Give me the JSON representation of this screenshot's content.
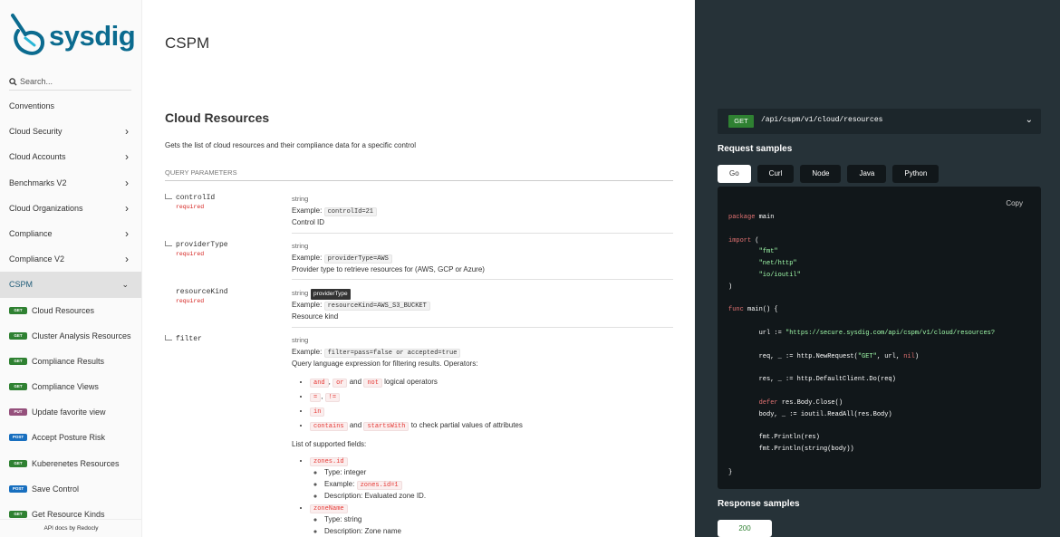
{
  "sidebar": {
    "logo_text": "sysdig",
    "search_placeholder": "Search...",
    "nav": [
      {
        "label": "Conventions"
      },
      {
        "label": "Cloud Security"
      },
      {
        "label": "Cloud Accounts"
      },
      {
        "label": "Benchmarks V2"
      },
      {
        "label": "Cloud Organizations"
      },
      {
        "label": "Compliance"
      },
      {
        "label": "Compliance V2"
      },
      {
        "label": "CSPM"
      }
    ],
    "sub_items": [
      {
        "method": "GET",
        "label": "Cloud Resources"
      },
      {
        "method": "GET",
        "label": "Cluster Analysis Resources"
      },
      {
        "method": "GET",
        "label": "Compliance Results"
      },
      {
        "method": "GET",
        "label": "Compliance Views"
      },
      {
        "method": "PUT",
        "label": "Update favorite view"
      },
      {
        "method": "POST",
        "label": "Accept Posture Risk"
      },
      {
        "method": "GET",
        "label": "Kuberenetes Resources"
      },
      {
        "method": "POST",
        "label": "Save Control"
      },
      {
        "method": "GET",
        "label": "Get Resource Kinds"
      }
    ],
    "footer": "API docs by Redocly",
    "colors": {
      "get": "#2f8132",
      "put": "#95507c",
      "post": "#186fbf"
    }
  },
  "main": {
    "page_title": "CSPM",
    "section_title": "Cloud Resources",
    "section_desc": "Gets the list of cloud resources and their compliance data for a specific control",
    "params_header": "QUERY PARAMETERS",
    "tooltip": "providerType",
    "params": [
      {
        "name": "controlId",
        "required": "required",
        "type": "string",
        "example_label": "Example:",
        "example": "controlId=21",
        "desc": "Control ID"
      },
      {
        "name": "providerType",
        "required": "required",
        "type": "string",
        "example_label": "Example:",
        "example": "providerType=AWS",
        "desc": "Provider type to retrieve resources for (AWS, GCP or Azure)"
      },
      {
        "name": "resourceKind",
        "required": "required",
        "type": "string",
        "example_label": "Example:",
        "example": "resourceKind=AWS_S3_BUCKET",
        "desc": "Resource kind"
      },
      {
        "name": "filter",
        "type": "string",
        "example_label": "Example:",
        "example": "filter=pass=false or accepted=true",
        "desc": "Query language expression for filtering results. Operators:"
      }
    ],
    "filter_ops": {
      "and": "and",
      "comma": ",",
      "or": "or",
      "and_word": "and",
      "not": "not",
      "logical_text": "logical operators",
      "eq": "=",
      "ne": "!=",
      "in": "in",
      "contains": "contains",
      "and_word2": "and",
      "startsWith": "startsWith",
      "partial_text": "to check partial values of attributes"
    },
    "fields_title": "List of supported fields:",
    "fields": [
      {
        "name": "zones.id",
        "type": "Type: integer",
        "example_label": "Example:",
        "example": "zones.id=1",
        "desc": "Description: Evaluated zone ID."
      },
      {
        "name": "zoneName",
        "type": "Type: string",
        "desc": "Description: Zone name"
      }
    ]
  },
  "right": {
    "method": "GET",
    "path": "/api/cspm/v1/cloud/resources",
    "request_title": "Request samples",
    "tabs": [
      "Go",
      "Curl",
      "Node",
      "Java",
      "Python"
    ],
    "copy": "Copy",
    "code": {
      "pkg": "package",
      "main_name": "main",
      "import": "import",
      "paren_open": "(",
      "imp1": "\"fmt\"",
      "imp2": "\"net/http\"",
      "imp3": "\"io/ioutil\"",
      "paren_close": ")",
      "func": "func",
      "func_sig": "main() {",
      "url_pre": "url := ",
      "url": "\"https://secure.sysdig.com/api/cspm/v1/cloud/resources?",
      "req_pre": "req, _ := http.NewRequest(",
      "req_method": "\"GET\"",
      "req_mid": ", url, ",
      "nil": "nil",
      "req_post": ")",
      "res": "res, _ := http.DefaultClient.Do(req)",
      "defer": "defer",
      "defer_rest": "res.Body.Close()",
      "body": "body, _ := ioutil.ReadAll(res.Body)",
      "print1": "fmt.Println(res)",
      "print2": "fmt.Println(string(body))",
      "close": "}"
    },
    "response_title": "Response samples",
    "response_tab": "200"
  }
}
